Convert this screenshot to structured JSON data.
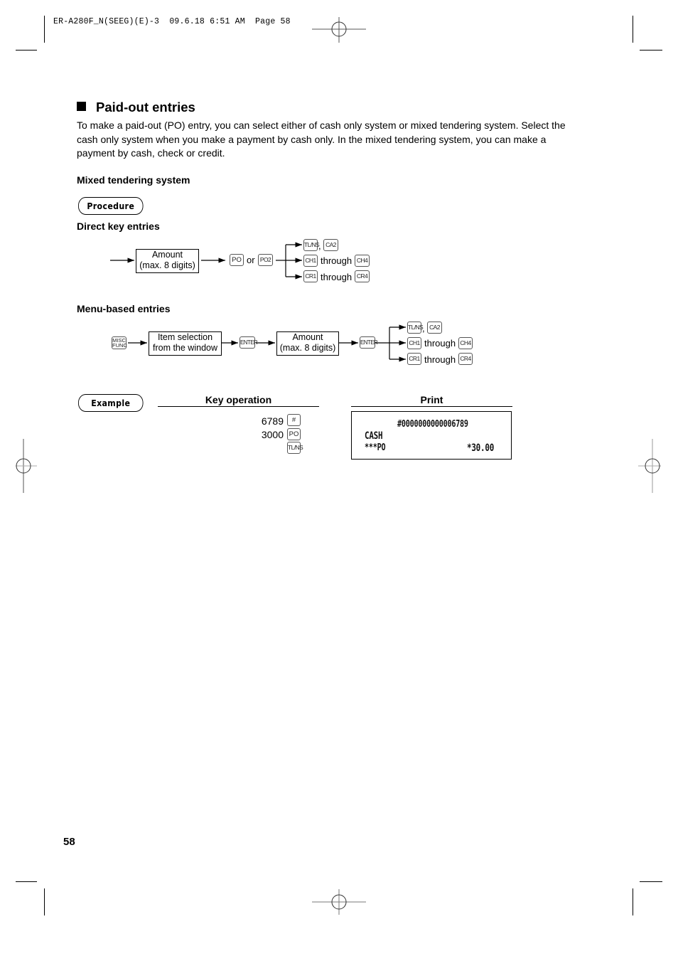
{
  "header": {
    "slug": "ER-A280F_N(SEEG)(E)-3  09.6.18 6:51 AM  Page 58"
  },
  "section": {
    "title": "Paid-out entries",
    "intro": "To make a paid-out (PO) entry, you can select either of cash only system or mixed tendering system. Select the cash only system when you make a payment by cash only.  In the mixed tendering system, you can make a payment by cash, check or credit.",
    "subtitle": "Mixed tendering system"
  },
  "procedure": {
    "badge": "Procedure",
    "direct": {
      "heading": "Direct key entries",
      "amount_box": [
        "Amount",
        "(max. 8 digits)"
      ],
      "key_po": "PO",
      "or_text": "or",
      "key_po2": "PO2",
      "branches": [
        {
          "key_a": "TL/NS",
          "sep": ",",
          "key_b": "CA2"
        },
        {
          "key_a": "CH1",
          "sep": "through",
          "key_b": "CH4"
        },
        {
          "key_a": "CR1",
          "sep": "through",
          "key_b": "CR4"
        }
      ]
    },
    "menu": {
      "heading": "Menu-based entries",
      "key_misc": [
        "MISC",
        "FUNC"
      ],
      "item_box": [
        "Item selection",
        "from the window"
      ],
      "key_enter": "ENTER",
      "amount_box": [
        "Amount",
        "(max. 8 digits)"
      ],
      "branches": [
        {
          "key_a": "TL/NS",
          "sep": ",",
          "key_b": "CA2"
        },
        {
          "key_a": "CH1",
          "sep": "through",
          "key_b": "CH4"
        },
        {
          "key_a": "CR1",
          "sep": "through",
          "key_b": "CR4"
        }
      ]
    }
  },
  "example": {
    "badge": "Example",
    "key_operation_header": "Key operation",
    "print_header": "Print",
    "key_ops": [
      {
        "value": "6789",
        "key": "#"
      },
      {
        "value": "3000",
        "key": "PO"
      },
      {
        "value": "",
        "key": "TL/NS"
      }
    ],
    "receipt": {
      "line1": "#0000000000006789",
      "line2": "CASH",
      "line3_left": "***PO",
      "line3_right": "*30.00"
    }
  },
  "footer": {
    "page_number": "58"
  }
}
